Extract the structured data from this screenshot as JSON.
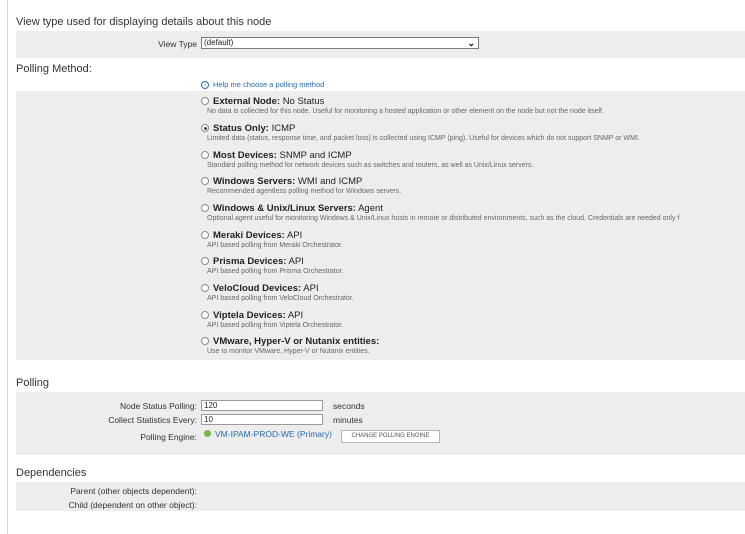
{
  "view_type_section": {
    "title": "View type used for displaying details about this node",
    "label": "View Type",
    "value": "(default)",
    "icon": "chevron-down-icon"
  },
  "polling_method": {
    "title": "Polling Method:",
    "help_link": "Help me choose a polling method",
    "selected": "Status Only",
    "options": [
      {
        "name": "External Node:",
        "suffix": "No Status",
        "desc": "No data is collected for this node. Useful for monitoring a hosted application or other element on the node but not the node itself."
      },
      {
        "name": "Status Only:",
        "suffix": "ICMP",
        "desc": "Limited data (status, response time, and packet loss) is collected using ICMP (ping). Useful for devices which do not support SNMP or WMI."
      },
      {
        "name": "Most Devices:",
        "suffix": "SNMP and ICMP",
        "desc": "Standard polling method for network devices such as switches and routers, as well as Unix/Linux servers."
      },
      {
        "name": "Windows Servers:",
        "suffix": "WMI and ICMP",
        "desc": "Recommended agentless polling method for Windows servers."
      },
      {
        "name": "Windows & Unix/Linux Servers:",
        "suffix": "Agent",
        "desc": "Optional agent useful for monitoring Windows & Unix/Linux hosts in remote or distributed environments, such as the cloud. Credentials are needed only f"
      },
      {
        "name": "Meraki Devices:",
        "suffix": "API",
        "desc": "API based polling from Meraki Orchestrator."
      },
      {
        "name": "Prisma Devices:",
        "suffix": "API",
        "desc": "API based polling from Prisma Orchestrator."
      },
      {
        "name": "VeloCloud Devices:",
        "suffix": "API",
        "desc": "API based polling from VeloCloud Orchestrator."
      },
      {
        "name": "Viptela Devices:",
        "suffix": "API",
        "desc": "API based polling from Viptela Orchestrator."
      },
      {
        "name": "VMware, Hyper-V or Nutanix entities:",
        "suffix": "",
        "desc": "Use to monitor VMware, Hyper-V or Nutanix entities."
      }
    ]
  },
  "polling": {
    "title": "Polling",
    "status_label": "Node Status Polling:",
    "status_value": "120",
    "status_unit": "seconds",
    "stats_label": "Collect Statistics Every:",
    "stats_value": "10",
    "stats_unit": "minutes",
    "engine_label": "Polling Engine:",
    "engine_value": "VM-IPAM-PROD-WE (Primary)",
    "engine_status_color": "#7ab648",
    "change_button": "CHANGE POLLING ENGINE"
  },
  "dependencies": {
    "title": "Dependencies",
    "parent_label": "Parent (other objects dependent):",
    "child_label": "Child (dependent on other object):"
  }
}
